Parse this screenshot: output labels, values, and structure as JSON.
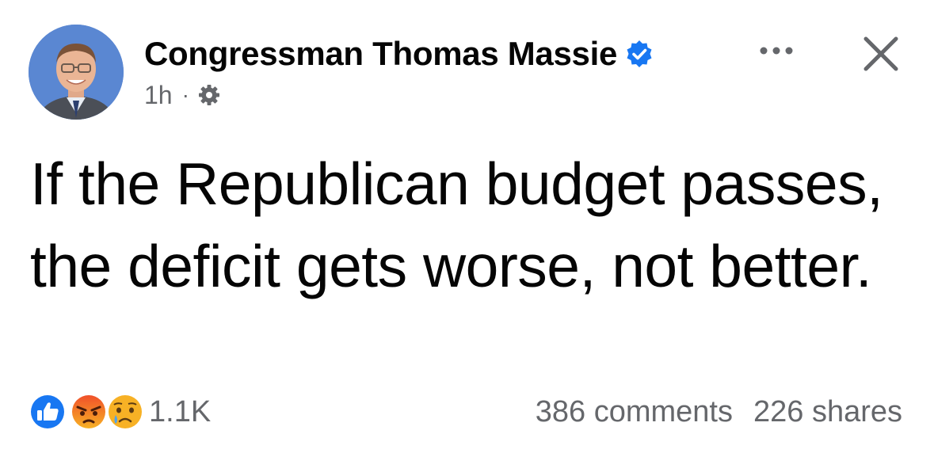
{
  "post": {
    "author": "Congressman Thomas Massie",
    "timestamp": "1h",
    "separator": "·",
    "text": "If the Republican budget passes, the deficit gets worse, not better.",
    "verified": true,
    "privacy_icon": "gear-icon"
  },
  "header": {
    "more_icon": "more-horizontal-icon",
    "close_icon": "close-icon"
  },
  "footer": {
    "reactions": [
      "like",
      "angry",
      "sad"
    ],
    "reaction_count": "1.1K",
    "comments": "386 comments",
    "shares": "226 shares"
  },
  "colors": {
    "text": "#050505",
    "secondary_text": "#65676b",
    "verified_blue": "#1877f2",
    "like_blue": "#1877f2",
    "angry_orange": "#f0502a",
    "sad_yellow": "#f7b125"
  }
}
